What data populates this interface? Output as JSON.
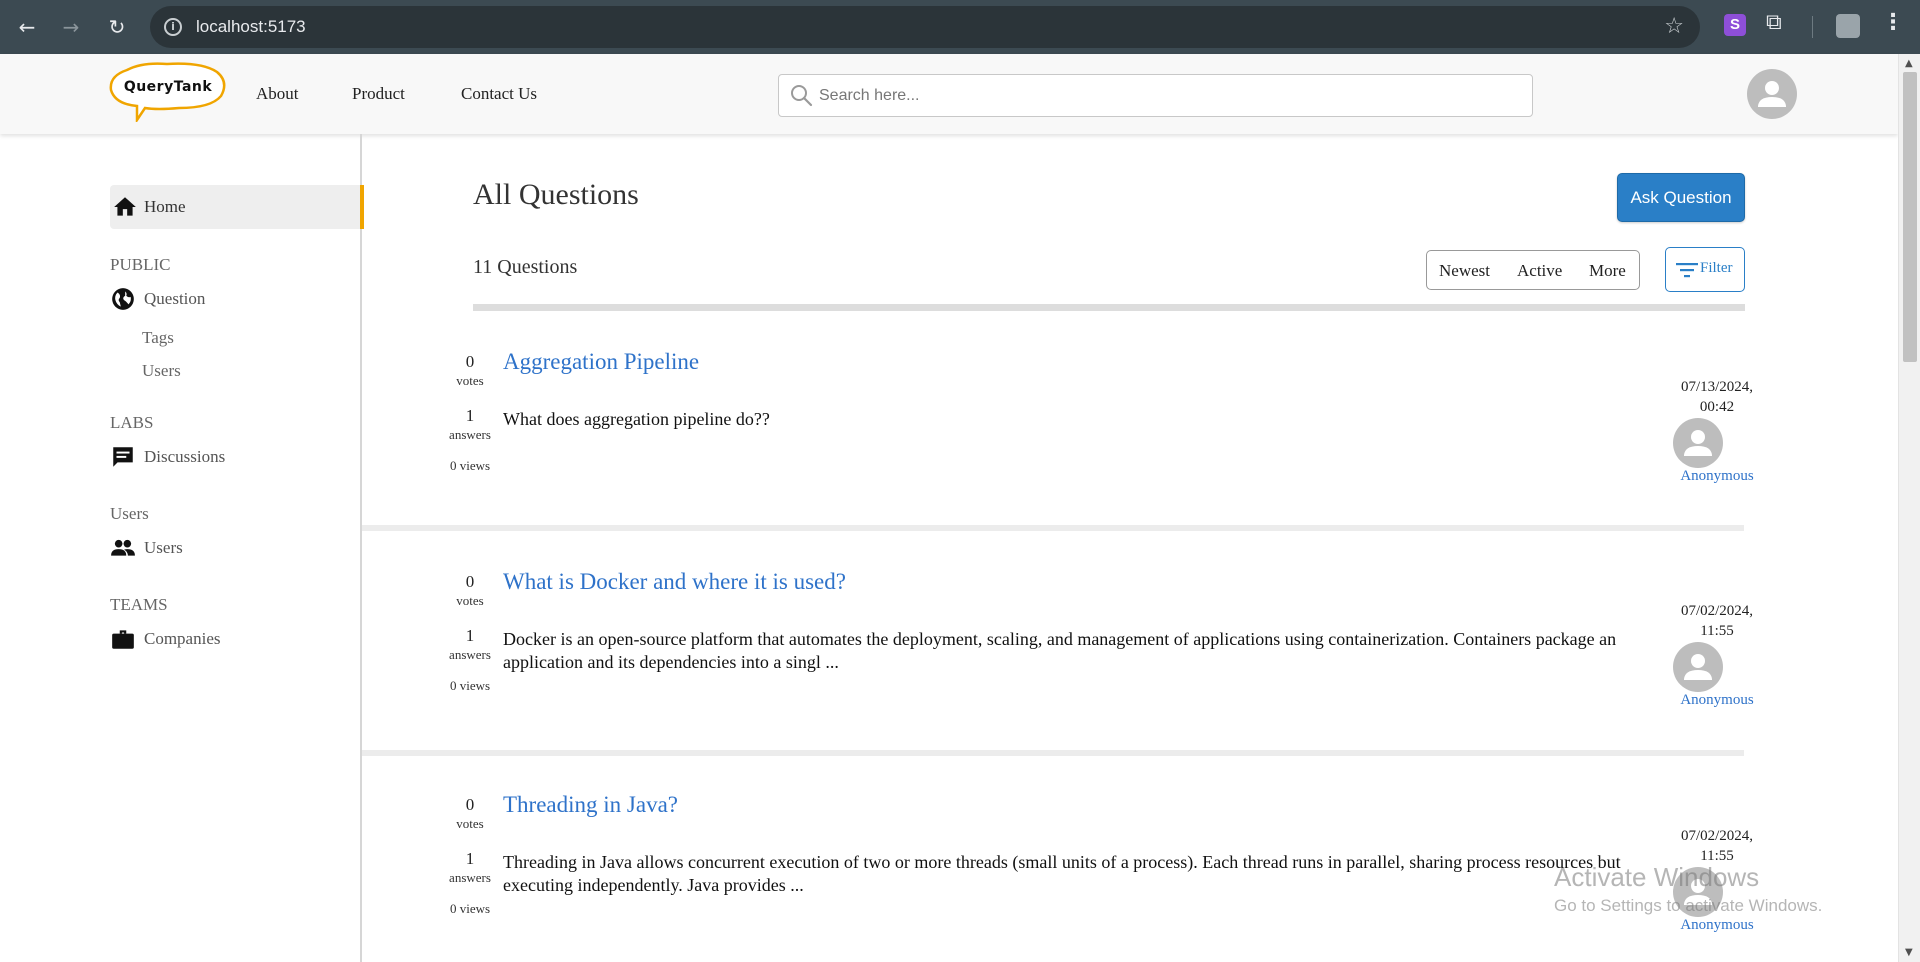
{
  "browser": {
    "url": "localhost:5173",
    "extension_letter": "S"
  },
  "header": {
    "logo_text": "QueryTank",
    "nav": [
      "About",
      "Product",
      "Contact Us"
    ],
    "search_placeholder": "Search here..."
  },
  "sidebar": {
    "home": "Home",
    "sections": [
      {
        "title": "PUBLIC",
        "item": "Question",
        "subitems": [
          "Tags",
          "Users"
        ]
      },
      {
        "title": "LABS",
        "item": "Discussions"
      },
      {
        "title": "Users",
        "item": "Users"
      },
      {
        "title": "TEAMS",
        "item": "Companies"
      }
    ]
  },
  "main": {
    "title": "All Questions",
    "ask_button": "Ask Question",
    "count_label": "11 Questions",
    "sort_options": [
      "Newest",
      "Active",
      "More"
    ],
    "filter_label": "Filter",
    "questions": [
      {
        "votes": "0",
        "votes_label": "votes",
        "answers": "1",
        "answers_label": "answers",
        "views": "0 views",
        "title": "Aggregation Pipeline",
        "body": "What does aggregation pipeline do??",
        "date": "07/13/2024,",
        "time": "00:42",
        "author": "Anonymous"
      },
      {
        "votes": "0",
        "votes_label": "votes",
        "answers": "1",
        "answers_label": "answers",
        "views": "0 views",
        "title": "What is Docker and where it is used?",
        "body": "Docker is an open-source platform that automates the deployment, scaling, and management of applications using containerization. Containers package an application and its dependencies into a singl ...",
        "date": "07/02/2024,",
        "time": "11:55",
        "author": "Anonymous"
      },
      {
        "votes": "0",
        "votes_label": "votes",
        "answers": "1",
        "answers_label": "answers",
        "views": "0 views",
        "title": "Threading in Java?",
        "body": "Threading in Java allows concurrent execution of two or more threads (small units of a process). Each thread runs in parallel, sharing process resources but executing independently. Java provides ...",
        "date": "07/02/2024,",
        "time": "11:55",
        "author": "Anonymous"
      }
    ]
  },
  "watermark": {
    "title": "Activate Windows",
    "subtitle": "Go to Settings to activate Windows."
  },
  "colors": {
    "accent": "#2a7fc7",
    "link": "#2e72c9",
    "active_indicator": "#f0a500",
    "chrome": "#3c4a52"
  }
}
